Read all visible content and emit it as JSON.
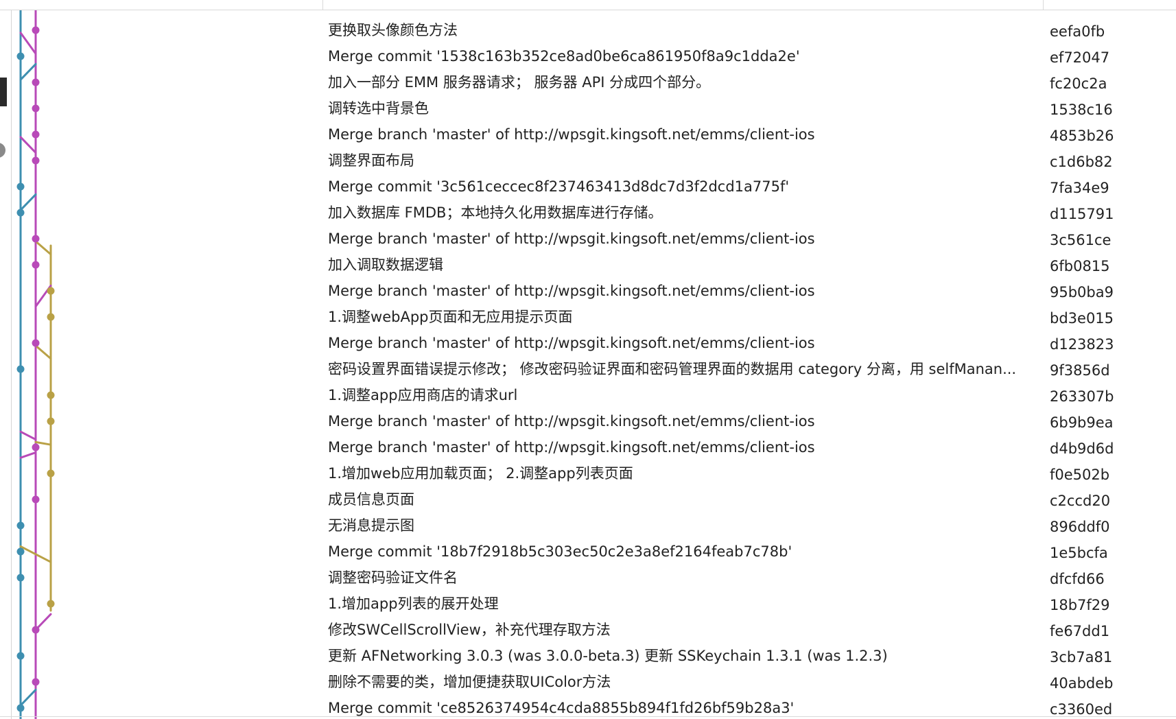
{
  "graph": {
    "colors": {
      "blue": "#3e8fb0",
      "magenta": "#b84ab8",
      "gold": "#b9a146"
    }
  },
  "commits": [
    {
      "description": "更换取头像颜色方法",
      "hash": "eefa0fb"
    },
    {
      "description": "Merge commit '1538c163b352ce8ad0be6ca861950f8a9c1dda2e'",
      "hash": "ef72047"
    },
    {
      "description": "加入一部分 EMM 服务器请求；  服务器 API 分成四个部分。",
      "hash": "fc20c2a"
    },
    {
      "description": "调转选中背景色",
      "hash": "1538c16"
    },
    {
      "description": "Merge branch 'master' of http://wpsgit.kingsoft.net/emms/client-ios",
      "hash": "4853b26"
    },
    {
      "description": "调整界面布局",
      "hash": "c1d6b82"
    },
    {
      "description": "Merge commit '3c561ceccec8f237463413d8dc7d3f2dcd1a775f'",
      "hash": "7fa34e9"
    },
    {
      "description": "加入数据库 FMDB；本地持久化用数据库进行存储。",
      "hash": "d115791"
    },
    {
      "description": "Merge branch 'master' of http://wpsgit.kingsoft.net/emms/client-ios",
      "hash": "3c561ce"
    },
    {
      "description": "加入调取数据逻辑",
      "hash": "6fb0815"
    },
    {
      "description": "Merge branch 'master' of http://wpsgit.kingsoft.net/emms/client-ios",
      "hash": "95b0ba9"
    },
    {
      "description": "1.调整webApp页面和无应用提示页面",
      "hash": "bd3e015"
    },
    {
      "description": "Merge branch 'master' of http://wpsgit.kingsoft.net/emms/client-ios",
      "hash": "d123823"
    },
    {
      "description": "密码设置界面错误提示修改；  修改密码验证界面和密码管理界面的数据用 category 分离，用 selfManan...",
      "hash": "9f3856d"
    },
    {
      "description": "1.调整app应用商店的请求url",
      "hash": "263307b"
    },
    {
      "description": "Merge branch 'master' of http://wpsgit.kingsoft.net/emms/client-ios",
      "hash": "6b9b9ea"
    },
    {
      "description": "Merge branch 'master' of http://wpsgit.kingsoft.net/emms/client-ios",
      "hash": "d4b9d6d"
    },
    {
      "description": "1.增加web应用加载页面；  2.调整app列表页面",
      "hash": "f0e502b"
    },
    {
      "description": "成员信息页面",
      "hash": "c2ccd20"
    },
    {
      "description": "无消息提示图",
      "hash": "896ddf0"
    },
    {
      "description": "Merge commit '18b7f2918b5c303ec50c2e3a8ef2164feab7c78b'",
      "hash": "1e5bcfa"
    },
    {
      "description": "调整密码验证文件名",
      "hash": "dfcfd66"
    },
    {
      "description": "1.增加app列表的展开处理",
      "hash": "18b7f29"
    },
    {
      "description": "修改SWCellScrollView，补充代理存取方法",
      "hash": "fe67dd1"
    },
    {
      "description": "更新 AFNetworking 3.0.3 (was 3.0.0-beta.3) 更新 SSKeychain 1.3.1 (was 1.2.3)",
      "hash": "3cb7a81"
    },
    {
      "description": "删除不需要的类，增加便捷获取UIColor方法",
      "hash": "40abdeb"
    },
    {
      "description": "Merge commit 'ce8526374954c4cda8855b894f1fd26bf59b28a3'",
      "hash": "c3360ed"
    }
  ]
}
